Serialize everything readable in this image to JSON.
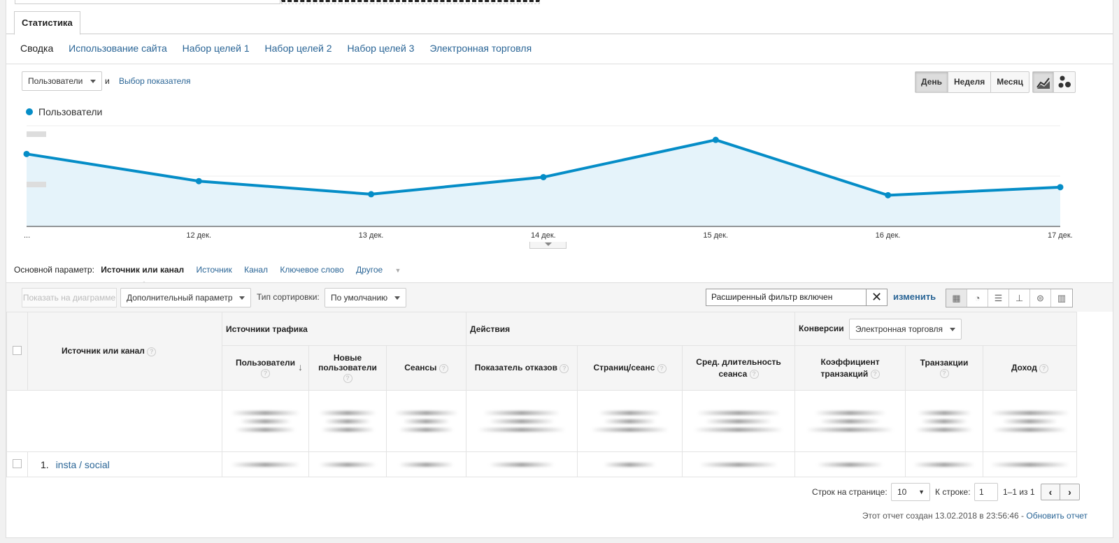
{
  "tabs": {
    "statistics": "Статистика"
  },
  "subnav": [
    "Сводка",
    "Использование сайта",
    "Набор целей 1",
    "Набор целей 2",
    "Набор целей 3",
    "Электронная торговля"
  ],
  "metric": {
    "selected": "Пользователи",
    "and": "и",
    "choose_link": "Выбор показателя"
  },
  "period": {
    "day": "День",
    "week": "Неделя",
    "month": "Месяц",
    "active": "day"
  },
  "chart_data": {
    "type": "area",
    "series": [
      {
        "name": "Пользователи",
        "color": "#058dc7",
        "values": [
          0.72,
          0.45,
          0.32,
          0.49,
          0.86,
          0.31,
          0.39
        ]
      }
    ],
    "x": [
      "...",
      "12 дек.",
      "13 дек.",
      "14 дек.",
      "15 дек.",
      "16 дек.",
      "17 дек."
    ],
    "ylim": [
      0,
      1
    ],
    "grid": true
  },
  "primary_dim": {
    "label": "Основной параметр:",
    "active": "Источник или канал",
    "options": [
      "Источник",
      "Канал",
      "Ключевое слово",
      "Другое"
    ]
  },
  "toolbar": {
    "plot_rows": "Показать на диаграмме",
    "secondary_dim": "Дополнительный параметр",
    "sort_label": "Тип сортировки:",
    "sort_value": "По умолчанию",
    "filter_text": "Расширенный фильтр включен",
    "edit_link": "изменить",
    "views": [
      "grid-icon",
      "pie-icon",
      "bar-icon",
      "compare-icon",
      "term-cloud-icon",
      "pivot-icon"
    ]
  },
  "table": {
    "dim_header": "Источник или канал",
    "group_traffic": "Источники трафика",
    "group_actions": "Действия",
    "group_conversions": "Конверсии",
    "conversion_select": "Электронная торговля",
    "columns": [
      {
        "l1": "Пользователи",
        "l2": ""
      },
      {
        "l1": "Новые",
        "l2": "пользователи"
      },
      {
        "l1": "Сеансы",
        "l2": ""
      },
      {
        "l1": "Показатель отказов",
        "l2": ""
      },
      {
        "l1": "Страниц/сеанс",
        "l2": ""
      },
      {
        "l1": "Сред. длительность",
        "l2": "сеанса"
      },
      {
        "l1": "Коэффициент",
        "l2": "транзакций"
      },
      {
        "l1": "Транзакции",
        "l2": ""
      },
      {
        "l1": "Доход",
        "l2": ""
      }
    ],
    "rows": [
      {
        "index": "1.",
        "name": "insta / social"
      }
    ]
  },
  "pagination": {
    "rows_label": "Строк на странице:",
    "rows_value": "10",
    "goto_label": "К строке:",
    "goto_value": "1",
    "range": "1–1 из 1",
    "prev": "‹",
    "next": "›"
  },
  "generated": {
    "text": "Этот отчет создан 13.02.2018 в 23:56:46 - ",
    "refresh": "Обновить отчет"
  }
}
